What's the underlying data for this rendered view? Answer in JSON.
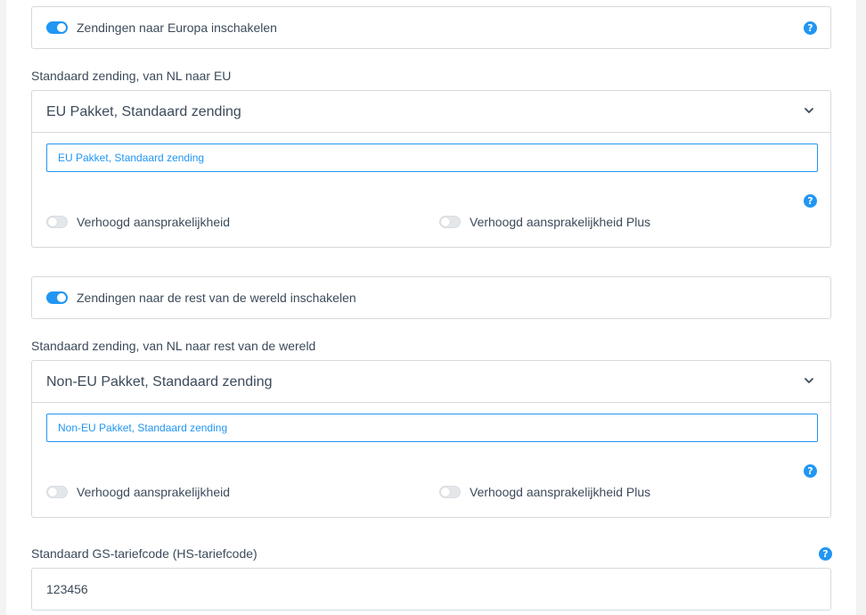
{
  "europe": {
    "toggle_label": "Zendingen naar Europa inschakelen",
    "toggle_on": true,
    "help_glyph": "?",
    "section_label": "Standaard zending, van NL naar EU",
    "selected_value": "EU Pakket, Standaard zending",
    "search_value": "EU Pakket, Standaard zending",
    "help_glyph_2": "?",
    "option1_label": "Verhoogd aansprakelijkheid",
    "option1_on": false,
    "option2_label": "Verhoogd aansprakelijkheid Plus",
    "option2_on": false
  },
  "world": {
    "toggle_label": "Zendingen naar de rest van de wereld inschakelen",
    "toggle_on": true,
    "section_label": "Standaard zending, van NL naar rest van de wereld",
    "selected_value": "Non-EU Pakket, Standaard zending",
    "search_value": "Non-EU Pakket, Standaard zending",
    "help_glyph": "?",
    "option1_label": "Verhoogd aansprakelijkheid",
    "option1_on": false,
    "option2_label": "Verhoogd aansprakelijkheid Plus",
    "option2_on": false
  },
  "hs_code": {
    "label": "Standaard GS-tariefcode (HS-tariefcode)",
    "help_glyph": "?",
    "value": "123456"
  },
  "colors": {
    "accent": "#2196f3",
    "border": "#d6d9dd",
    "text": "#3c4a5a",
    "page_bg": "#f3f3f3"
  },
  "icons": [
    "help-icon",
    "chevron-down-icon",
    "toggle-switch"
  ]
}
